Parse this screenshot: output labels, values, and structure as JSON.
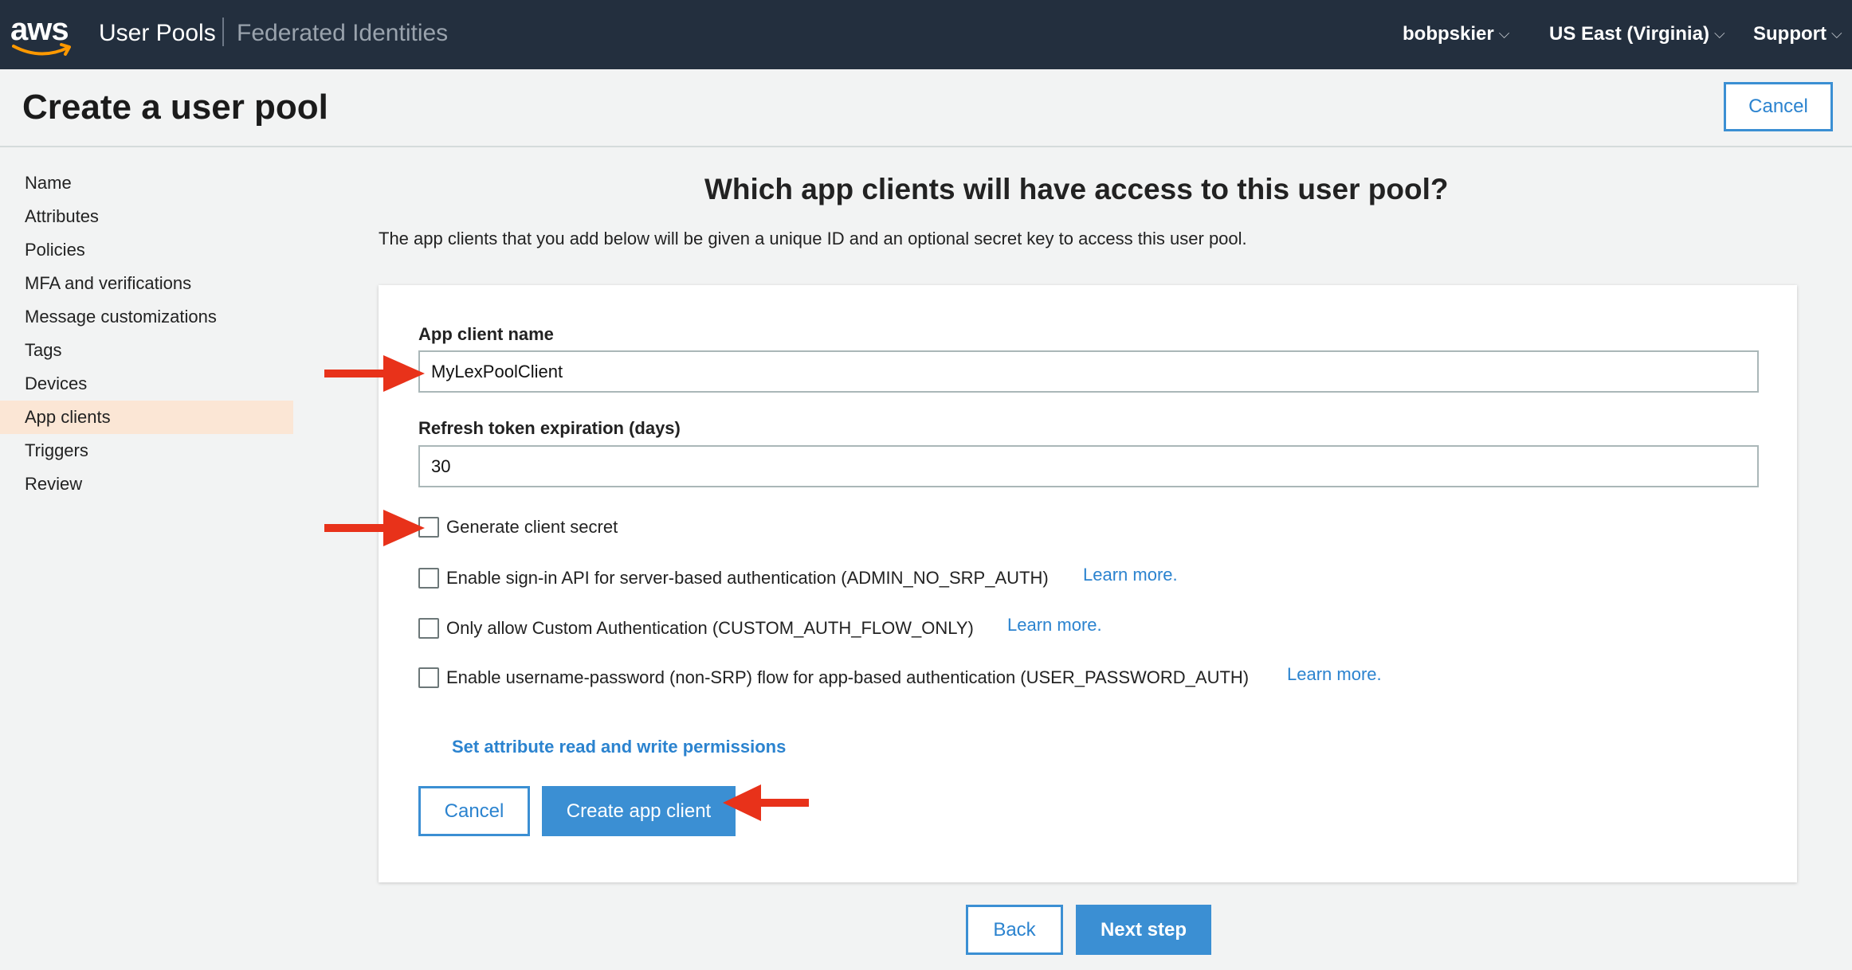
{
  "topbar": {
    "logo_text": "aws",
    "user_pools": "User Pools",
    "federated": "Federated Identities",
    "account": "bobpskier",
    "region": "US East (Virginia)",
    "support": "Support",
    "chevron": "⌵"
  },
  "header": {
    "title": "Create a user pool",
    "cancel_label": "Cancel"
  },
  "sidebar": {
    "items": [
      {
        "label": "Name"
      },
      {
        "label": "Attributes"
      },
      {
        "label": "Policies"
      },
      {
        "label": "MFA and verifications"
      },
      {
        "label": "Message customizations"
      },
      {
        "label": "Tags"
      },
      {
        "label": "Devices"
      },
      {
        "label": "App clients",
        "active": true
      },
      {
        "label": "Triggers"
      },
      {
        "label": "Review"
      }
    ]
  },
  "main": {
    "title": "Which app clients will have access to this user pool?",
    "description": "The app clients that you add below will be given a unique ID and an optional secret key to access this user pool."
  },
  "form": {
    "app_client_name_label": "App client name",
    "app_client_name_value": "MyLexPoolClient",
    "refresh_label": "Refresh token expiration (days)",
    "refresh_value": "30",
    "checkboxes": [
      {
        "label": "Generate client secret",
        "checked": false
      },
      {
        "label": "Enable sign-in API for server-based authentication (ADMIN_NO_SRP_AUTH)",
        "checked": false,
        "link": "Learn more."
      },
      {
        "label": "Only allow Custom Authentication (CUSTOM_AUTH_FLOW_ONLY)",
        "checked": false,
        "link": "Learn more."
      },
      {
        "label": "Enable username-password (non-SRP) flow for app-based authentication (USER_PASSWORD_AUTH)",
        "checked": false,
        "link": "Learn more."
      }
    ],
    "permissions_link": "Set attribute read and write permissions",
    "cancel_label": "Cancel",
    "create_label": "Create app client"
  },
  "footer": {
    "back_label": "Back",
    "next_label": "Next step"
  },
  "colors": {
    "nav_bg": "#232f3e",
    "accent": "#3b8fd3",
    "annotation_arrow": "#e8321a",
    "active_bg": "#fbe6d5"
  }
}
